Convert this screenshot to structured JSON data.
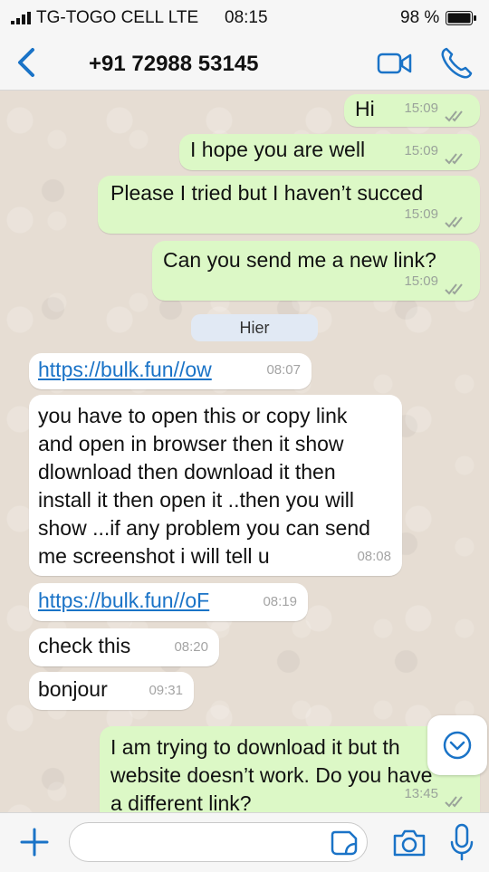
{
  "status_bar": {
    "carrier": "TG-TOGO CELL LTE",
    "time": "08:15",
    "battery": "98 %"
  },
  "header": {
    "contact": "+91 72988 53145",
    "icons": [
      "chevron-left-icon",
      "video-call-icon",
      "phone-call-icon"
    ]
  },
  "messages": [
    {
      "dir": "out",
      "text": "Hi",
      "time": "15:09",
      "read": true
    },
    {
      "dir": "out",
      "text": "I hope you are well",
      "time": "15:09",
      "read": true
    },
    {
      "dir": "out",
      "text": "Please I tried but I haven’t succed",
      "time": "15:09",
      "read": true
    },
    {
      "dir": "out",
      "text": "Can you send me a new link?",
      "time": "15:09",
      "read": true
    },
    {
      "dir": "in",
      "text": "https://bulk.fun//ow",
      "time": "08:07",
      "link": true
    },
    {
      "dir": "in",
      "lines": [
        "you have to open this or copy link",
        "and open in browser then it show",
        "dlownload then download it then",
        "install it then open it ..then you will",
        "show ...if any problem you can send",
        "me screenshot i will tell u"
      ],
      "time": "08:08"
    },
    {
      "dir": "in",
      "text": "https://bulk.fun//oF",
      "time": "08:19",
      "link": true
    },
    {
      "dir": "in",
      "text": "check this",
      "time": "08:20"
    },
    {
      "dir": "in",
      "text": "bonjour",
      "time": "09:31"
    },
    {
      "dir": "out",
      "lines": [
        "I am trying to download it but th",
        "website doesn’t work. Do you have",
        "a different link?"
      ],
      "time": "13:45",
      "read": true
    }
  ],
  "date_separator": "Hier",
  "composer": {
    "placeholder": "",
    "icons": [
      "plus-icon",
      "sticker-icon",
      "camera-icon",
      "microphone-icon"
    ]
  },
  "colors": {
    "accent": "#1a73c7",
    "outgoing_bubble": "#dcf8c6",
    "incoming_bubble": "#ffffff",
    "chat_background": "#e6ddd3"
  }
}
